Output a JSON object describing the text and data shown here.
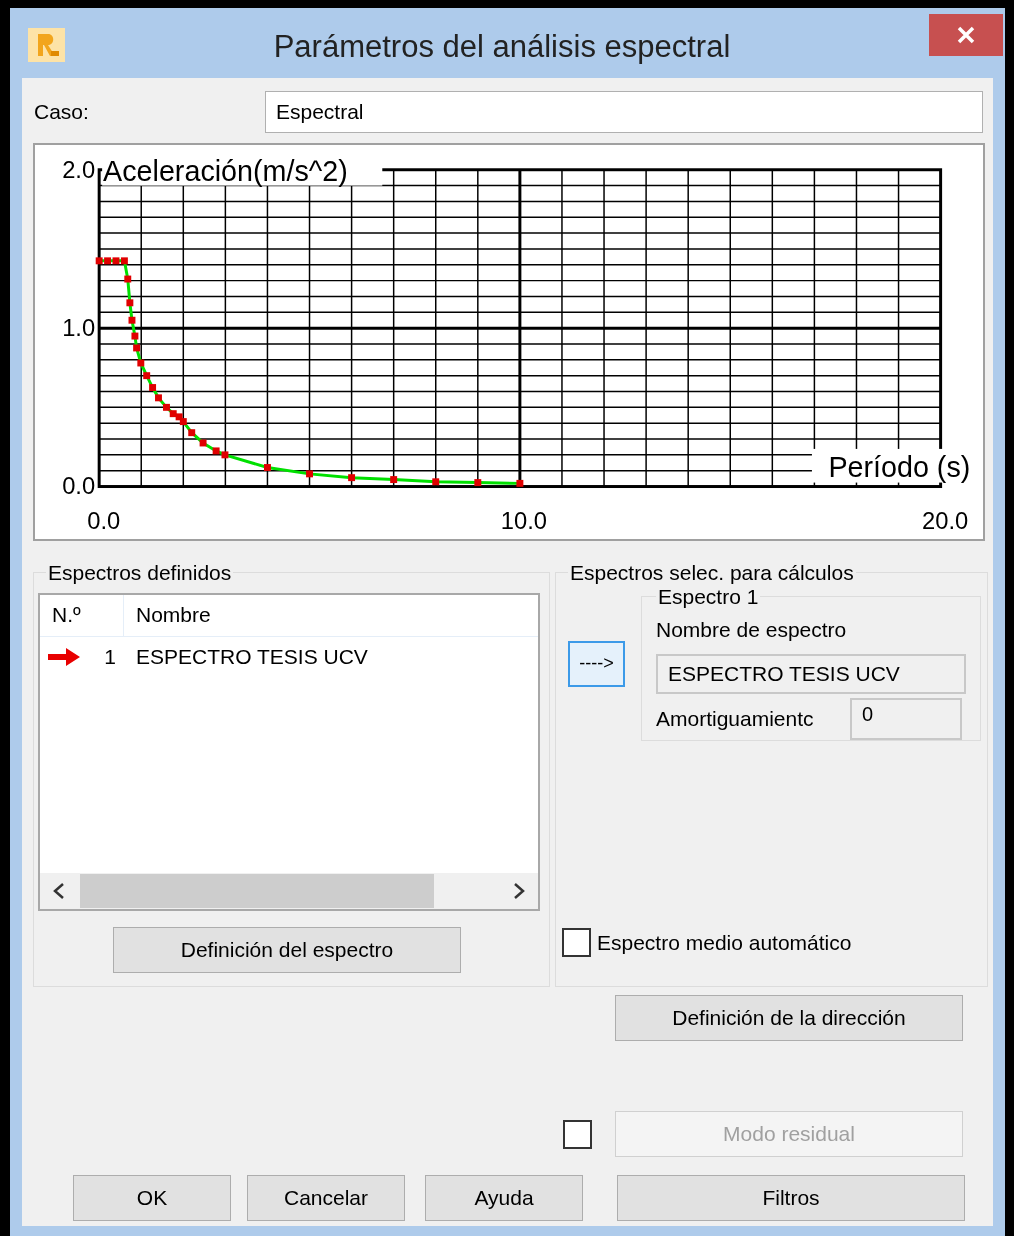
{
  "window": {
    "title": "Parámetros del análisis espectral"
  },
  "case": {
    "label": "Caso:",
    "value": "Espectral"
  },
  "chart": {
    "chart_data": {
      "type": "line",
      "xlabel": "Período (s)",
      "ylabel": "Aceleración(m/s^2)",
      "x": [
        0,
        0.2,
        0.4,
        0.6,
        0.68,
        0.73,
        0.78,
        0.85,
        0.89,
        0.99,
        1.13,
        1.27,
        1.41,
        1.6,
        1.76,
        1.9,
        2.0,
        2.2,
        2.47,
        2.78,
        2.99,
        4.0,
        5.0,
        6.0,
        7.0,
        8.0,
        9.0,
        10.0
      ],
      "series": [
        {
          "color": "#00e000",
          "marker": "square",
          "values": [
            1.425,
            1.425,
            1.425,
            1.425,
            1.31,
            1.16,
            1.05,
            0.95,
            0.875,
            0.78,
            0.7,
            0.625,
            0.56,
            0.5,
            0.46,
            0.44,
            0.41,
            0.34,
            0.275,
            0.225,
            0.2,
            0.12,
            0.08,
            0.056,
            0.044,
            0.03,
            0.025,
            0.02
          ]
        }
      ],
      "xlim": [
        0,
        20
      ],
      "ylim": [
        0,
        2
      ],
      "xticks": [
        {
          "value": 0,
          "label": "0.0"
        },
        {
          "value": 10,
          "label": "10.0"
        },
        {
          "value": 20,
          "label": "20.0"
        }
      ],
      "yticks": [
        {
          "value": 0,
          "label": "0.0"
        },
        {
          "value": 1,
          "label": "1.0"
        },
        {
          "value": 2,
          "label": "2.0"
        }
      ]
    }
  },
  "defined_spectra": {
    "title": "Espectros definidos",
    "columns": [
      "N.º",
      "Nombre"
    ],
    "rows": [
      {
        "number": "1",
        "name": "ESPECTRO TESIS UCV",
        "current": true
      }
    ],
    "button": "Definición del espectro"
  },
  "selected_spectra": {
    "title": "Espectros selec. para cálculos",
    "add_button": "---->",
    "spectrum": {
      "title": "Espectro 1",
      "name_label": "Nombre de espectro",
      "name_value": "ESPECTRO TESIS UCV",
      "damping_label": "Amortiguamientc",
      "damping_value": "0"
    },
    "auto_mean": {
      "label": "Espectro medio automático",
      "checked": false
    }
  },
  "direction_button": "Definición de la dirección",
  "residual": {
    "checked": false,
    "label": "Modo residual",
    "disabled": true
  },
  "buttons": [
    "OK",
    "Cancelar",
    "Ayuda",
    "Filtros"
  ]
}
